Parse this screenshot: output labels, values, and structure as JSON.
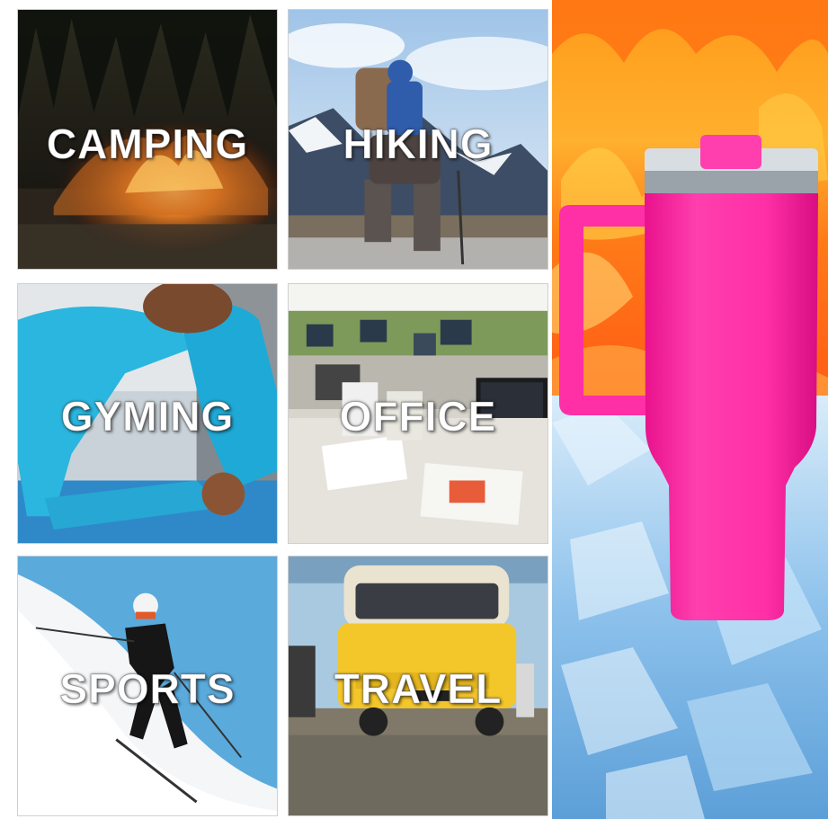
{
  "tiles": [
    {
      "id": "camping",
      "label": "CAMPING"
    },
    {
      "id": "hiking",
      "label": "HIKING"
    },
    {
      "id": "gyming",
      "label": "GYMING"
    },
    {
      "id": "office",
      "label": "OFFICE"
    },
    {
      "id": "sports",
      "label": "SPORTS"
    },
    {
      "id": "travel",
      "label": "TRAVEL"
    }
  ],
  "colors": {
    "tumbler_pink": "#ff2fa6",
    "fire_orange": "#ff8a1a",
    "ice_blue": "#7fb9ea",
    "label_text": "#ffffff"
  },
  "icons": [
    "tumbler-image",
    "fire-background",
    "ice-background"
  ]
}
